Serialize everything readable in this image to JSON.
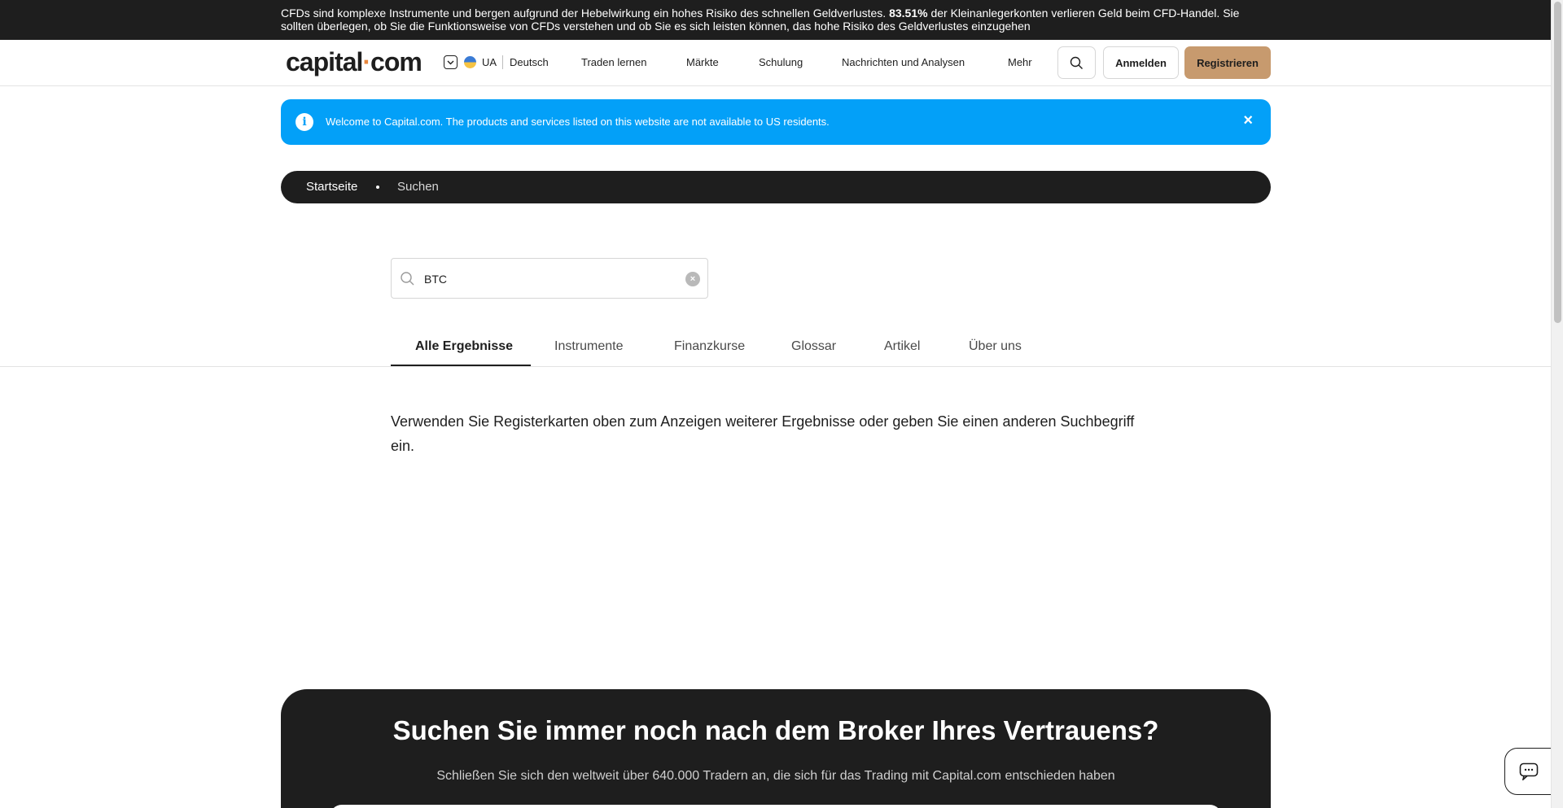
{
  "risk_banner": {
    "text_before": "CFDs sind komplexe Instrumente und bergen aufgrund der Hebelwirkung ein hohes Risiko des schnellen Geldverlustes. ",
    "percentage": "83.51%",
    "text_after": " der Kleinanlegerkonten verlieren Geld beim CFD-Handel. Sie sollten überlegen, ob Sie die Funktionsweise von CFDs verstehen und ob Sie es sich leisten können, das hohe Risiko des Geldverlustes einzugehen"
  },
  "header": {
    "logo_left": "capital",
    "logo_dot": "·",
    "logo_right": "com",
    "region": "UA",
    "language": "Deutsch",
    "nav": [
      "Traden lernen",
      "Märkte",
      "Schulung",
      "Nachrichten und Analysen",
      "Mehr"
    ],
    "login_label": "Anmelden",
    "register_label": "Registrieren"
  },
  "notice": {
    "icon": "info-icon",
    "text": "Welcome to Capital.com. The products and services listed on this website are not available to US residents.",
    "close": "×"
  },
  "breadcrumb": {
    "home": "Startseite",
    "current": "Suchen"
  },
  "search": {
    "value": "BTC",
    "clear_icon": "clear-icon"
  },
  "tabs": [
    "Alle Ergebnisse",
    "Instrumente",
    "Finanzkurse",
    "Glossar",
    "Artikel",
    "Über uns"
  ],
  "active_tab": "Alle Ergebnisse",
  "results": {
    "message": "Verwenden Sie Registerkarten oben zum Anzeigen weiterer Ergebnisse oder geben Sie einen anderen Suchbegriff ein."
  },
  "cta": {
    "title": "Suchen Sie immer noch nach dem Broker Ihres Vertrauens?",
    "subtitle": "Schließen Sie sich den weltweit über 640.000 Tradern an, die sich für das Trading mit Capital.com entschieden haben"
  },
  "colors": {
    "accent": "#c79a6e",
    "notice_blue": "#03a0f8",
    "dark": "#1e1e1e",
    "logo_dot": "#e8873d"
  }
}
